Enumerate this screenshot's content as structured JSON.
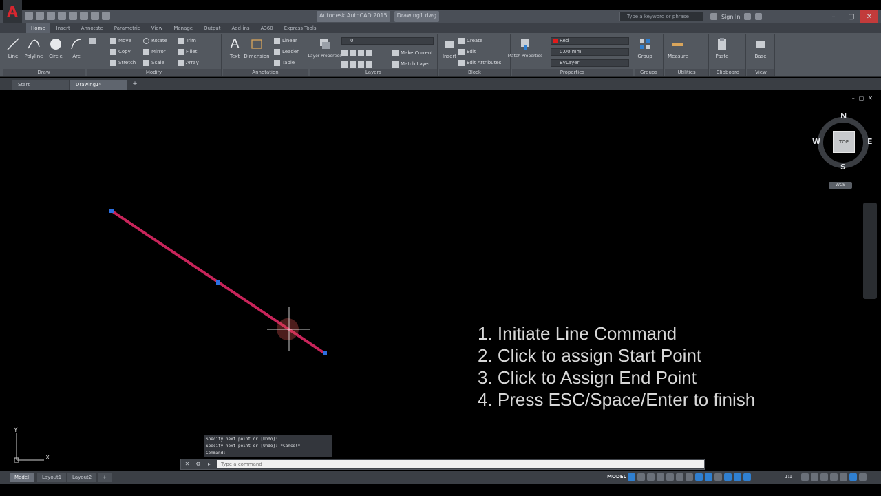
{
  "app": {
    "logo": "A",
    "title_chips": [
      "Autodesk AutoCAD 2015",
      "Drawing1.dwg"
    ],
    "search_placeholder": "Type a keyword or phrase",
    "sign_in": "Sign In"
  },
  "ribbon_tabs": [
    "Home",
    "Insert",
    "Annotate",
    "Parametric",
    "View",
    "Manage",
    "Output",
    "Add-ins",
    "A360",
    "Express Tools"
  ],
  "ribbon": {
    "draw": {
      "title": "Draw",
      "line": "Line",
      "polyline": "Polyline",
      "circle": "Circle",
      "arc": "Arc"
    },
    "modify": {
      "title": "Modify",
      "move": "Move",
      "rotate": "Rotate",
      "trim": "Trim",
      "copy": "Copy",
      "mirror": "Mirror",
      "fillet": "Fillet",
      "stretch": "Stretch",
      "scale": "Scale",
      "array": "Array"
    },
    "annotation": {
      "title": "Annotation",
      "text": "Text",
      "dimension": "Dimension",
      "linear": "Linear",
      "leader": "Leader",
      "table": "Table"
    },
    "layers": {
      "title": "Layers",
      "layer_properties": "Layer Properties",
      "layer_value": "0",
      "make_current": "Make Current",
      "match_layer": "Match Layer"
    },
    "block": {
      "title": "Block",
      "insert": "Insert",
      "create": "Create",
      "edit": "Edit",
      "edit_attributes": "Edit Attributes"
    },
    "properties": {
      "title": "Properties",
      "match_properties": "Match Properties",
      "color": "Red",
      "lineweight": "0.00 mm",
      "linetype": "ByLayer"
    },
    "groups": {
      "title": "Groups",
      "group": "Group"
    },
    "utilities": {
      "title": "Utilities",
      "measure": "Measure"
    },
    "clipboard": {
      "title": "Clipboard",
      "paste": "Paste"
    },
    "view": {
      "title": "View",
      "base": "Base"
    }
  },
  "doc_tabs": [
    "Start",
    "Drawing1*"
  ],
  "viewcube": {
    "top": "TOP",
    "n": "N",
    "s": "S",
    "e": "E",
    "w": "W",
    "wcs": "WCS"
  },
  "instructions": [
    "1. Initiate Line Command",
    "2. Click to assign Start Point",
    "3. Click to Assign End Point",
    "4. Press ESC/Space/Enter to finish"
  ],
  "ucs": {
    "x": "X",
    "y": "Y"
  },
  "command": {
    "history": [
      "Specify next point or [Undo]:",
      "Specify next point or [Undo]: *Cancel*",
      "Command:"
    ],
    "placeholder": "Type a command"
  },
  "layout_tabs": [
    "Model",
    "Layout1",
    "Layout2"
  ],
  "status": {
    "model": "MODEL",
    "scale": "1:1"
  },
  "colors": {
    "line": "#c8245a",
    "grip": "#2c6fe0",
    "ribbon": "#53585f",
    "canvas": "#000000"
  }
}
